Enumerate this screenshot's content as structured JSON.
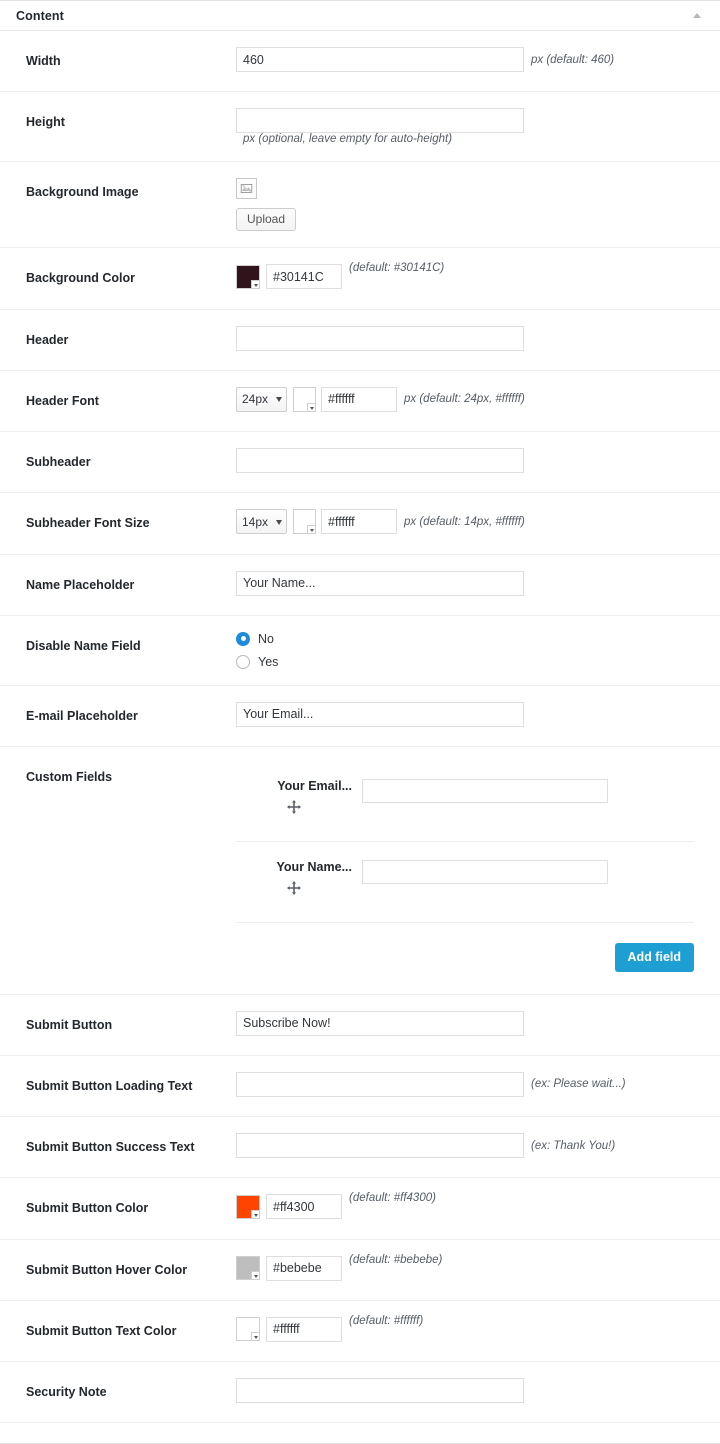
{
  "panel": {
    "title": "Content",
    "toggle_icon": "caret-up-icon"
  },
  "rows": {
    "width": {
      "label": "Width",
      "value": "460",
      "hint": "px (default: 460)"
    },
    "height": {
      "label": "Height",
      "value": "",
      "hint": "px (optional, leave empty for auto-height)"
    },
    "background_image": {
      "label": "Background Image",
      "icon": "broken-image-icon",
      "upload_label": "Upload"
    },
    "background_color": {
      "label": "Background Color",
      "swatch_color": "#30141C",
      "value": "#30141C",
      "hint": "(default: #30141C)"
    },
    "header": {
      "label": "Header",
      "value": ""
    },
    "header_font": {
      "label": "Header Font",
      "size_value": "24px",
      "swatch_color": "#ffffff",
      "color_value": "#ffffff",
      "hint": "px (default: 24px, #ffffff)"
    },
    "subheader": {
      "label": "Subheader",
      "value": ""
    },
    "subheader_font_size": {
      "label": "Subheader Font Size",
      "size_value": "14px",
      "swatch_color": "#ffffff",
      "color_value": "#ffffff",
      "hint": "px (default: 14px, #ffffff)"
    },
    "name_placeholder": {
      "label": "Name Placeholder",
      "value": "Your Name..."
    },
    "disable_name_field": {
      "label": "Disable Name Field",
      "options": [
        {
          "label": "No",
          "selected": true
        },
        {
          "label": "Yes",
          "selected": false
        }
      ]
    },
    "email_placeholder": {
      "label": "E-mail Placeholder",
      "value": "Your Email..."
    },
    "custom_fields": {
      "label": "Custom Fields",
      "items": [
        {
          "name": "Your Email...",
          "value": "",
          "handle_icon": "move-handle-icon"
        },
        {
          "name": "Your Name...",
          "value": "",
          "handle_icon": "move-handle-icon"
        }
      ],
      "add_label": "Add field",
      "add_color": "#1e9fd4"
    },
    "submit_button": {
      "label": "Submit Button",
      "value": "Subscribe Now!"
    },
    "submit_loading_text": {
      "label": "Submit Button Loading Text",
      "value": "",
      "hint": "(ex: Please wait...)"
    },
    "submit_success_text": {
      "label": "Submit Button Success Text",
      "value": "",
      "hint": "(ex: Thank You!)"
    },
    "submit_button_color": {
      "label": "Submit Button Color",
      "swatch_color": "#ff4300",
      "value": "#ff4300",
      "hint": "(default: #ff4300)"
    },
    "submit_hover_color": {
      "label": "Submit Button Hover Color",
      "swatch_color": "#bebebe",
      "value": "#bebebe",
      "hint": "(default: #bebebe)"
    },
    "submit_text_color": {
      "label": "Submit Button Text Color",
      "swatch_color": "#ffffff",
      "value": "#ffffff",
      "hint": "(default: #ffffff)"
    },
    "security_note": {
      "label": "Security Note",
      "value": ""
    }
  }
}
